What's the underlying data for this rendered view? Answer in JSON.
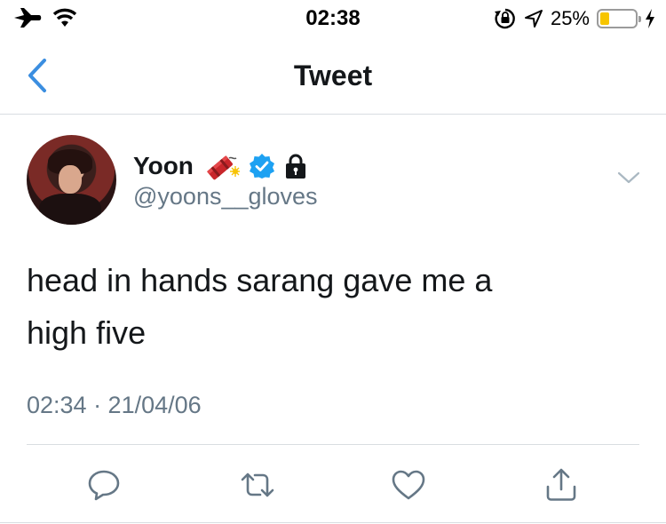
{
  "status_bar": {
    "time": "02:38",
    "battery_percent": "25%",
    "battery_level": 0.25,
    "icons": [
      "airplane-icon",
      "wifi-icon",
      "orientation-lock-icon",
      "location-icon",
      "battery-icon",
      "charging-bolt-icon"
    ]
  },
  "nav": {
    "title": "Tweet",
    "back_icon": "chevron-left-icon"
  },
  "tweet": {
    "author": {
      "display_name": "Yoon",
      "handle": "@yoons__gloves",
      "badges": [
        "firecracker-emoji",
        "verified-badge-icon",
        "lock-icon"
      ]
    },
    "text_line1": "head in hands sarang gave me a",
    "text_line2": "high five",
    "timestamp": "02:34 · 21/04/06"
  },
  "actions": [
    "reply-icon",
    "retweet-icon",
    "like-icon",
    "share-icon"
  ],
  "colors": {
    "accent": "#1da1f2",
    "back_chevron": "#3b8ee0",
    "secondary_text": "#657786",
    "divider": "#d9dde1",
    "battery_fill": "#f7c500"
  }
}
